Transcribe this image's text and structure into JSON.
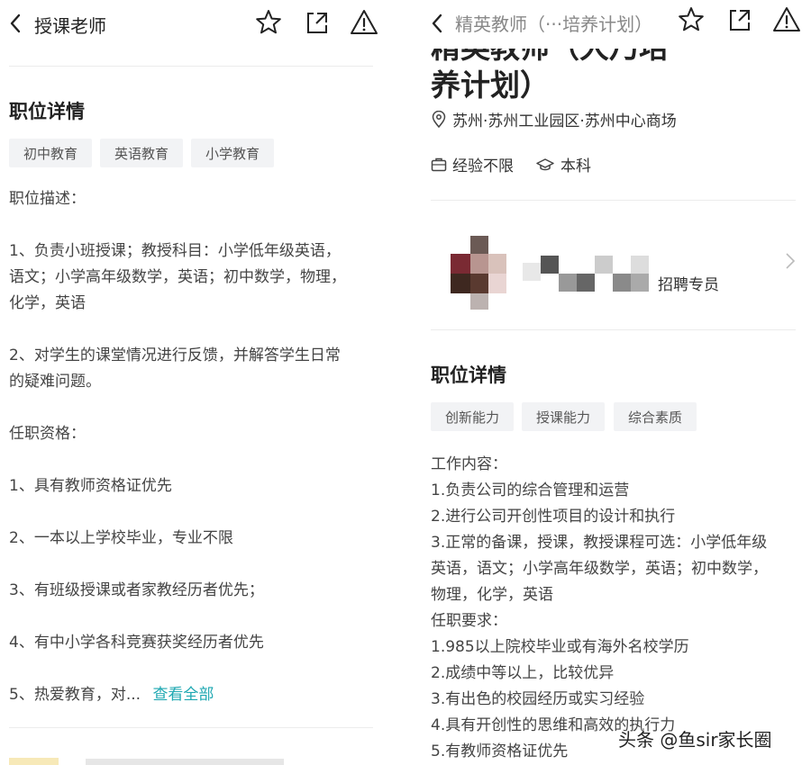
{
  "left": {
    "title": "授课老师",
    "section_title": "职位详情",
    "tags": [
      "初中教育",
      "英语教育",
      "小学教育"
    ],
    "lines": [
      "职位描述：",
      "1、负责小班授课；教授科目：小学低年级英语，",
      "语文；小学高年级数学，英语；初中数学，物理，",
      "化学，英语",
      "2、对学生的课堂情况进行反馈，并解答学生日常",
      "的疑难问题。",
      "任职资格：",
      "1、具有教师资格证优先",
      "2、一本以上学校毕业，专业不限",
      "3、有班级授课或者家教经历者优先；",
      "4、有中小学各科竞赛获奖经历者优先"
    ],
    "last_line": "5、热爱教育，对...",
    "view_all": "查看全部"
  },
  "right": {
    "title": "精英教师（···培养计划）",
    "big_title_cut": "精英教师（大乃培",
    "big_title": "养计划）",
    "location": "苏州·苏州工业园区·苏州中心商场",
    "experience": "经验不限",
    "education": "本科",
    "recruiter_role": "招聘专员",
    "section_title": "职位详情",
    "tags": [
      "创新能力",
      "授课能力",
      "综合素质"
    ],
    "lines": [
      "工作内容：",
      "1.负责公司的综合管理和运营",
      "2.进行公司开创性项目的设计和执行",
      "3.正常的备课，授课，教授课程可选：小学低年级",
      "英语，语文；小学高年级数学，英语；初中数学，",
      "物理，化学，英语",
      "任职要求：",
      "1.985以上院校毕业或有海外名校学历",
      "2.成绩中等以上，比较优异",
      "3.有出色的校园经历或实习经验",
      "4.具有开创性的思维和高效的执行力",
      "5.有教师资格证优先"
    ]
  },
  "watermark": "头条 @鱼sir家长圈",
  "colors": {
    "link": "#1fa8b2",
    "tag_bg": "#f2f3f5"
  }
}
